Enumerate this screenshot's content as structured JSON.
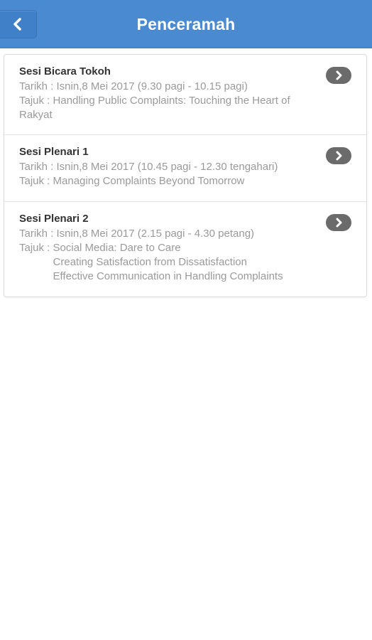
{
  "header": {
    "title": "Penceramah",
    "back_icon": "chevron-left-icon"
  },
  "sessions": [
    {
      "title": "Sesi Bicara Tokoh",
      "date_line": "Tarikh : Isnin,8 Mei 2017 (9.30 pagi - 10.15 pagi)",
      "topic_prefix": "Tajuk : ",
      "topic": "Handling Public Complaints: Touching the Heart of Rakyat",
      "icon": "chevron-right-icon"
    },
    {
      "title": "Sesi Plenari 1",
      "date_line": "Tarikh : Isnin,8 Mei 2017 (10.45 pagi - 12.30 tengahari)",
      "topic_prefix": "Tajuk : ",
      "topic": "Managing Complaints Beyond Tomorrow",
      "icon": "chevron-right-icon"
    },
    {
      "title": "Sesi Plenari 2",
      "date_line": "Tarikh : Isnin,8 Mei 2017 (2.15 pagi - 4.30 petang)",
      "topic_prefix": "Tajuk : ",
      "topics": [
        "Social Media: Dare to Care",
        "Creating Satisfaction from Dissatisfaction",
        "Effective Communication in Handling Complaints"
      ],
      "icon": "chevron-right-icon"
    }
  ],
  "colors": {
    "header_bg": "#4a8ad1",
    "title_text": "#333333",
    "detail_text": "#9a9a9a",
    "arrow_bg": "#6b6b6b"
  }
}
